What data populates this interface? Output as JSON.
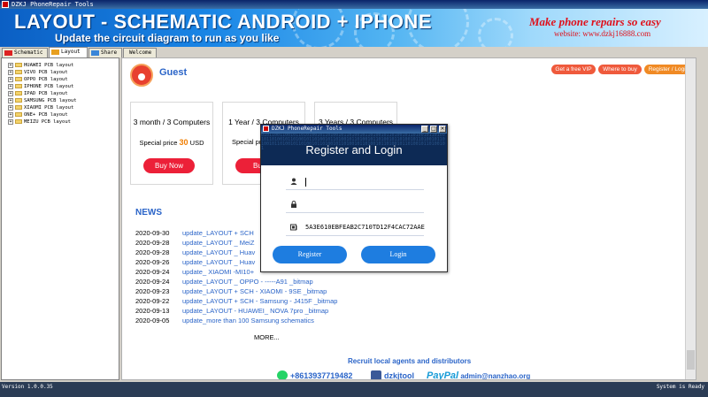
{
  "window": {
    "title": "DZKJ PhoneRepair Tools"
  },
  "banner": {
    "headline": "LAYOUT - SCHEMATIC ANDROID + IPHONE",
    "subline": "Update the circuit diagram to run as you like",
    "slogan": "Make phone repairs so easy",
    "website": "website: www.dzkj16888.com"
  },
  "tabs": [
    {
      "label": "Schematic",
      "icon": "pdf-icon"
    },
    {
      "label": "Layout",
      "icon": "pads-icon"
    },
    {
      "label": "Share",
      "icon": "share-icon"
    },
    {
      "label": "Welcome",
      "icon": ""
    }
  ],
  "tree": {
    "items": [
      "HUAWEI PCB layout",
      "VIVO PCB layout",
      "OPPO PCB layout",
      "IPHONE PCB layout",
      "IPAD PCB layout",
      "SAMSUNG PCB layout",
      "XIAOMI PCB layout",
      "ONE+ PCB layout",
      "MEIZU PCB layout"
    ]
  },
  "main": {
    "user": "Guest",
    "buttons": {
      "vip": "Get a free VIP",
      "where": "Where to buy",
      "register": "Register / Login"
    },
    "cards": [
      {
        "title": "3 month / 3 Computers",
        "price_prefix": "Special price",
        "price": "30",
        "currency": "USD",
        "button": "Buy Now"
      },
      {
        "title": "1 Year / 3 Computers",
        "price_prefix": "Special pr",
        "price": "",
        "currency": "",
        "button": "Bu"
      },
      {
        "title": "3 Years / 3 Computers",
        "price_prefix": "",
        "price": "",
        "currency": "",
        "button": ""
      }
    ],
    "news_title": "NEWS",
    "news": [
      {
        "date": "2020-09-30",
        "text": "update_LAYOUT + SCH"
      },
      {
        "date": "2020-09-28",
        "text": "update_LAYOUT _ MeiZ"
      },
      {
        "date": "2020-09-28",
        "text": "update_LAYOUT _ Huav"
      },
      {
        "date": "2020-09-26",
        "text": "update_LAYOUT _ Huav"
      },
      {
        "date": "2020-09-24",
        "text": "update_ XIAOMI -MI10+"
      },
      {
        "date": "2020-09-24",
        "text": "update_LAYOUT _ OPPO - -----A91 _bitmap"
      },
      {
        "date": "2020-09-23",
        "text": "update_LAYOUT + SCH - XIAOMI - 9SE _bitmap"
      },
      {
        "date": "2020-09-22",
        "text": "update_LAYOUT + SCH - Samsung - J415F _bitmap"
      },
      {
        "date": "2020-09-13",
        "text": "update_LAYOUT - HUAWEI_ NOVA 7pro _bitmap"
      },
      {
        "date": "2020-09-05",
        "text": "update_more than 100 Samsung schematics"
      }
    ],
    "more": "MORE...",
    "recruit": "Recruit local agents and distributors",
    "phone": "+8613937719482",
    "facebook": "dzkjtool",
    "paypal_brand": "PayPal",
    "paypal_email": "admin@nanzhao.org"
  },
  "dialog": {
    "title": "DZKJ PhoneRepair Tools",
    "heading": "Register and Login",
    "username_value": "",
    "password_value": "",
    "machine_code": "5A3E610EBFEAB2C710TD12F4CAC72AAE",
    "register_label": "Register",
    "login_label": "Login",
    "code_rain": "0101100110010110101001011010010110100101101001011010010110100101101001011010010110100101101001011010010110100101101001011010010110100101101001011010010110100101101001011010010110100101101001011010010110100101"
  },
  "status": {
    "left": "Version 1.0.0.35",
    "right": "System is Ready"
  },
  "colors": {
    "accent": "#2a64c8",
    "buy": "#ec2038",
    "price": "#f07d00",
    "dialog_button": "#1e7de0"
  }
}
